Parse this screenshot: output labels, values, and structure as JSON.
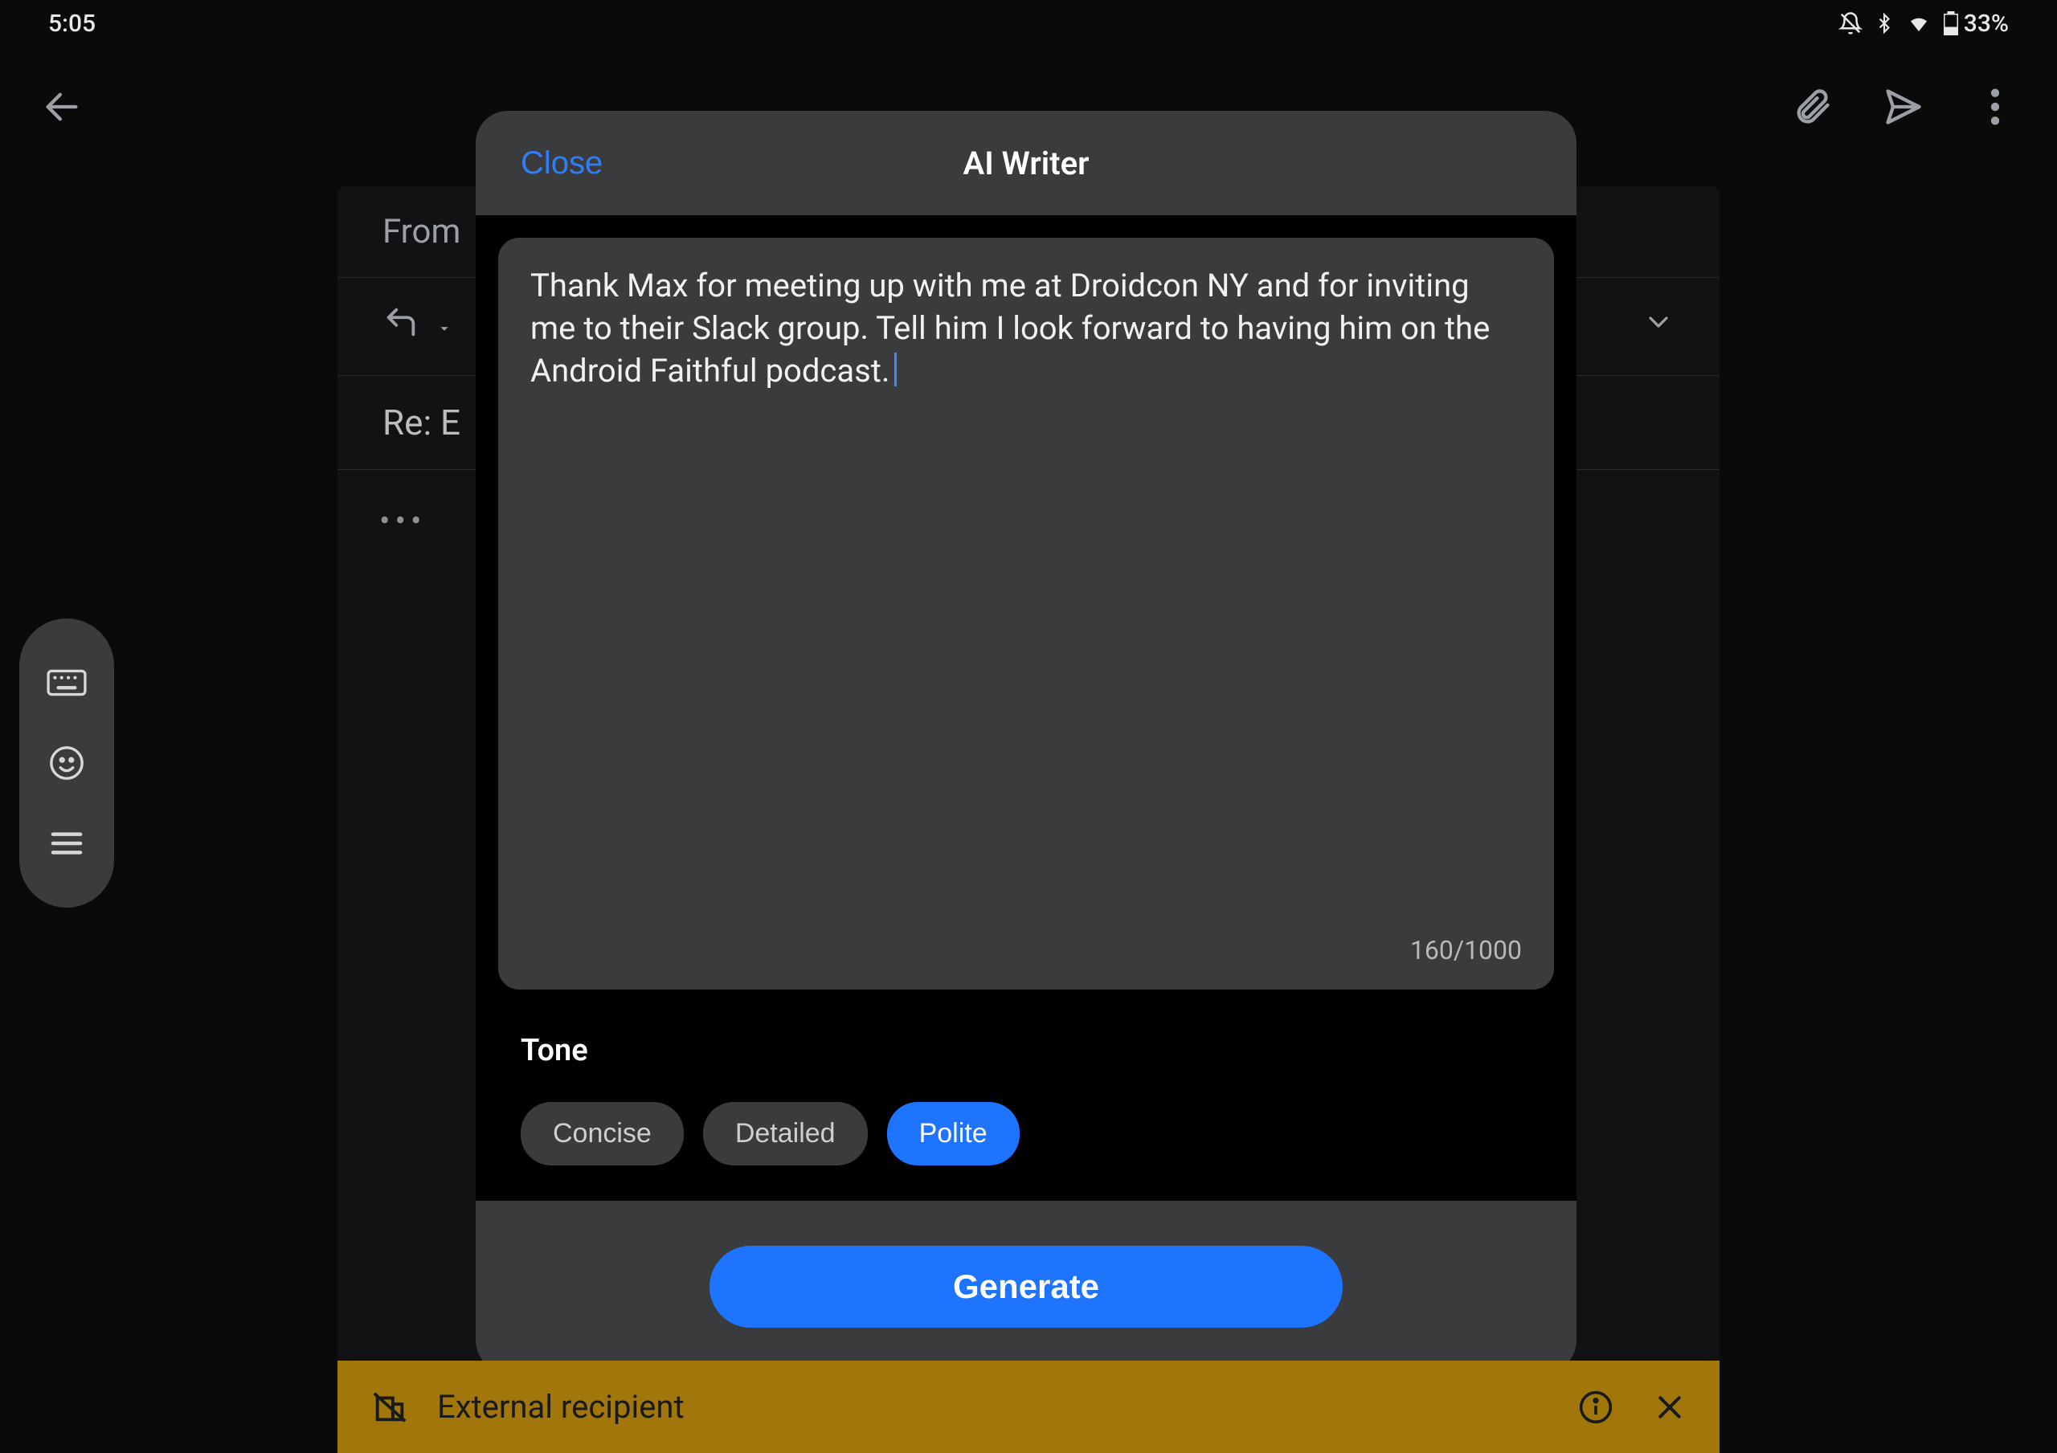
{
  "status": {
    "time": "5:05",
    "battery_pct": "33%"
  },
  "compose": {
    "from_label": "From",
    "subject_prefix": "Re: E",
    "body_placeholder": "•••"
  },
  "modal": {
    "close_label": "Close",
    "title": "AI Writer",
    "prompt_text": "Thank Max for meeting up with me at Droidcon NY and for inviting me to their Slack group. Tell him I look forward to having him on the Android Faithful podcast.",
    "char_count": "160/1000",
    "tone_label": "Tone",
    "tone_options": [
      "Concise",
      "Detailed",
      "Polite"
    ],
    "tone_selected_index": 2,
    "generate_label": "Generate"
  },
  "banner": {
    "text": "External recipient"
  }
}
